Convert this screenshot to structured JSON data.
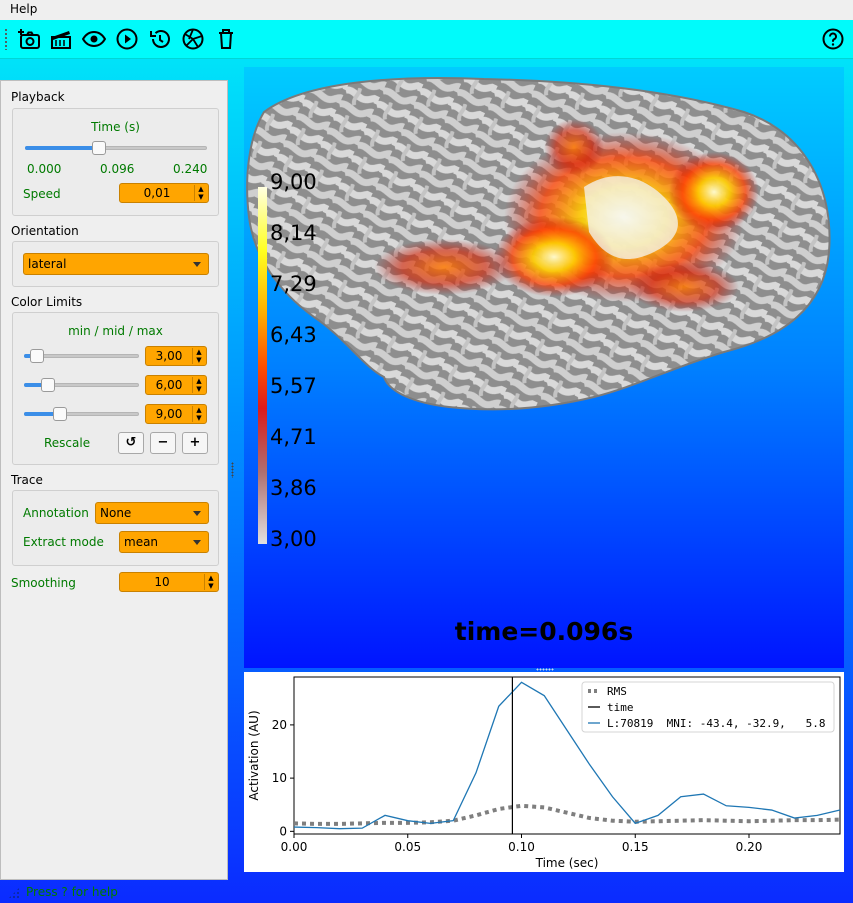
{
  "menu": {
    "help": "Help"
  },
  "toolbar": {
    "buttons": [
      {
        "name": "screenshot",
        "icon": "camera-add-icon"
      },
      {
        "name": "movie",
        "icon": "clapperboard-icon"
      },
      {
        "name": "toggle-interface",
        "icon": "eye-icon"
      },
      {
        "name": "play",
        "icon": "play-icon"
      },
      {
        "name": "reset",
        "icon": "history-icon"
      },
      {
        "name": "restore",
        "icon": "shutter-icon"
      },
      {
        "name": "clear",
        "icon": "trash-icon"
      }
    ],
    "help_icon": "help-icon"
  },
  "playback": {
    "section": "Playback",
    "time_label": "Time (s)",
    "time_fraction": 0.4,
    "time_min": "0.000",
    "time_current": "0.096",
    "time_max": "0.240",
    "speed_label": "Speed",
    "speed_value": "0,01"
  },
  "orientation": {
    "section": "Orientation",
    "value": "lateral"
  },
  "color_limits": {
    "section": "Color Limits",
    "label": "min / mid / max",
    "min": "3,00",
    "mid": "6,00",
    "max": "9,00",
    "min_fraction": 0.1,
    "mid_fraction": 0.2,
    "max_fraction": 0.3,
    "rescale_label": "Rescale",
    "reset_glyph": "↺",
    "minus_glyph": "−",
    "plus_glyph": "+"
  },
  "trace_panel": {
    "section": "Trace",
    "annotation_label": "Annotation",
    "annotation_value": "None",
    "extract_label": "Extract mode",
    "extract_value": "mean",
    "smoothing_label": "Smoothing",
    "smoothing_value": "10"
  },
  "brain_view": {
    "time_text": "time=0.096s",
    "colorbar_ticks": [
      "9,00",
      "8,14",
      "7,29",
      "6,43",
      "5,57",
      "4,71",
      "3,86",
      "3,00"
    ]
  },
  "status": {
    "text": "Press ? for help"
  },
  "chart_data": {
    "type": "line",
    "xlabel": "Time (sec)",
    "ylabel": "Activation (AU)",
    "xlim": [
      0.0,
      0.24
    ],
    "ylim": [
      -0.5,
      29
    ],
    "xticks": [
      "0.00",
      "0.05",
      "0.10",
      "0.15",
      "0.20"
    ],
    "yticks": [
      "0",
      "10",
      "20"
    ],
    "grid": false,
    "legend_position": "top-right",
    "time_marker": 0.096,
    "series": [
      {
        "name": "L:70819  MNI: -43.4, -32.9,   5.8",
        "color": "#1f77b4",
        "style": "solid",
        "x": [
          0.0,
          0.01,
          0.02,
          0.03,
          0.04,
          0.05,
          0.06,
          0.07,
          0.08,
          0.09,
          0.1,
          0.11,
          0.12,
          0.13,
          0.14,
          0.15,
          0.16,
          0.17,
          0.18,
          0.19,
          0.2,
          0.21,
          0.22,
          0.23,
          0.24
        ],
        "y": [
          0.8,
          0.7,
          0.5,
          0.6,
          3.0,
          2.0,
          1.5,
          2.0,
          11.0,
          23.5,
          28.0,
          25.5,
          19.0,
          12.5,
          6.5,
          1.5,
          3.0,
          6.5,
          7.0,
          4.8,
          4.5,
          4.0,
          2.5,
          3.0,
          4.0
        ]
      },
      {
        "name": "RMS",
        "color": "#7f7f7f",
        "style": "dotted",
        "x": [
          0.0,
          0.01,
          0.02,
          0.03,
          0.04,
          0.05,
          0.06,
          0.07,
          0.08,
          0.09,
          0.1,
          0.11,
          0.12,
          0.13,
          0.14,
          0.15,
          0.16,
          0.17,
          0.18,
          0.19,
          0.2,
          0.21,
          0.22,
          0.23,
          0.24
        ],
        "y": [
          1.5,
          1.4,
          1.4,
          1.5,
          1.6,
          1.6,
          1.7,
          2.0,
          3.0,
          4.2,
          4.8,
          4.5,
          3.5,
          2.5,
          2.0,
          1.8,
          1.9,
          2.0,
          2.1,
          2.0,
          1.9,
          2.0,
          2.1,
          2.1,
          2.2
        ]
      },
      {
        "name": "time",
        "color": "#000000",
        "style": "solid"
      }
    ]
  }
}
